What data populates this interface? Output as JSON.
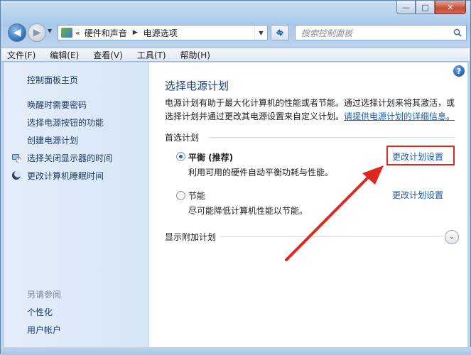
{
  "window": {
    "minimize_glyph": "—",
    "maximize_glyph": "□",
    "close_glyph": "✕"
  },
  "nav": {
    "back_glyph": "◀",
    "forward_glyph": "▶",
    "breadcrumb_prefix": "«",
    "breadcrumb": [
      "硬件和声音",
      "电源选项"
    ],
    "breadcrumb_separator": "▶",
    "search_placeholder": "搜索控制面板"
  },
  "menubar": {
    "items": [
      "文件(F)",
      "编辑(E)",
      "查看(V)",
      "工具(T)",
      "帮助(H)"
    ]
  },
  "sidebar": {
    "items": [
      {
        "label": "控制面板主页",
        "icon": null
      },
      {
        "label": "唤醒时需要密码",
        "icon": null
      },
      {
        "label": "选择电源按钮的功能",
        "icon": null
      },
      {
        "label": "创建电源计划",
        "icon": null
      },
      {
        "label": "选择关闭显示器的时间",
        "icon": "monitor-clock-icon"
      },
      {
        "label": "更改计算机睡眠时间",
        "icon": "moon-icon"
      }
    ],
    "see_also_header": "另请参阅",
    "see_also": [
      "个性化",
      "用户帐户"
    ]
  },
  "main": {
    "help_glyph": "?",
    "title": "选择电源计划",
    "description_line1": "电源计划有助于最大化计算机的性能或者节能。通过选择计划来将其激活，或",
    "description_line2": "选择计划并通过更改其电源设置来自定义计划。",
    "description_link": "请提供电源计划的详细信息。",
    "preferred_plans_label": "首选计划",
    "plans": [
      {
        "name": "平衡 (推荐)",
        "description": "利用可用的硬件自动平衡功耗与性能。",
        "selected": true,
        "link": "更改计划设置"
      },
      {
        "name": "节能",
        "description": "尽可能降低计算机性能以节能。",
        "selected": false,
        "link": "更改计划设置"
      }
    ],
    "show_additional_label": "显示附加计划",
    "expand_glyph": "⌄"
  },
  "annotation": {
    "color": "#e0271f"
  }
}
